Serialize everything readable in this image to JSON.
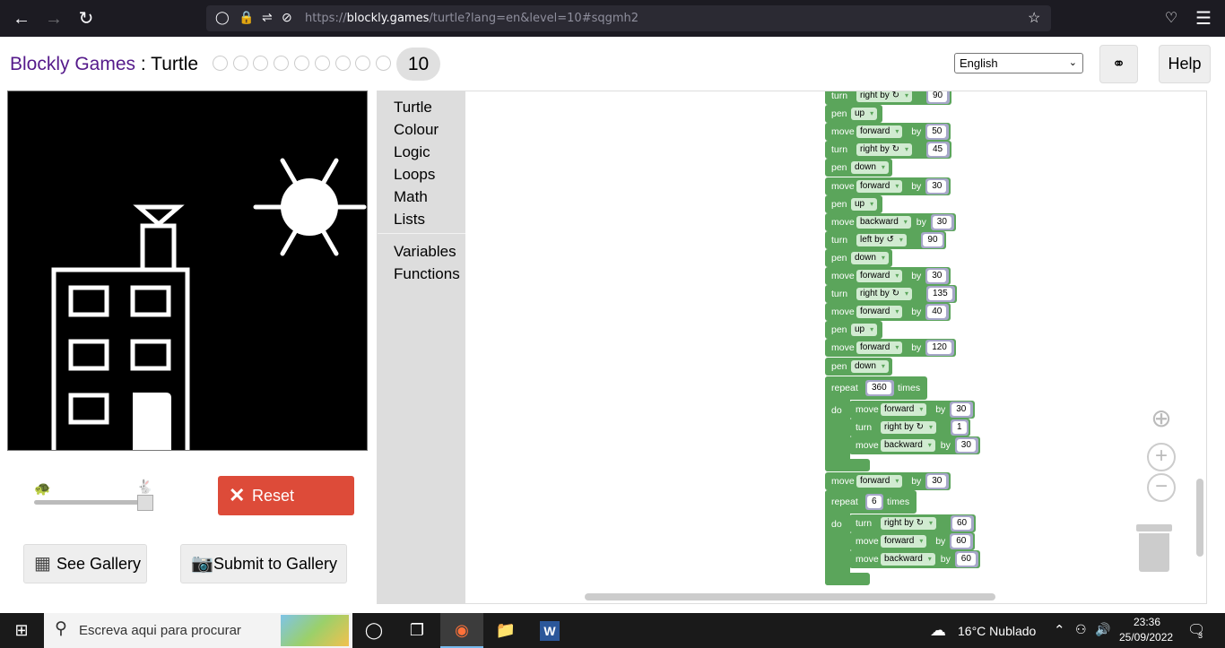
{
  "browser": {
    "url_prefix": "https://",
    "url_domain": "blockly.games",
    "url_rest": "/turtle?lang=en&level=10#sqgmh2"
  },
  "header": {
    "brand_games": "Blockly Games",
    "brand_sep": " : ",
    "brand_app": "Turtle",
    "current_level": "10",
    "language": "English",
    "help_label": "Help"
  },
  "controls": {
    "reset_label": "Reset",
    "see_gallery_label": "See Gallery",
    "submit_gallery_label": "Submit to Gallery",
    "speed_fraction": 0.97
  },
  "toolbox": {
    "items": [
      "Turtle",
      "Colour",
      "Logic",
      "Loops",
      "Math",
      "Lists",
      "Variables",
      "Functions"
    ]
  },
  "blocks": {
    "rows": [
      {
        "kw": "turn",
        "dd": "right by ↻",
        "val": "90"
      },
      {
        "kw": "pen",
        "dd": "up"
      },
      {
        "kw": "move",
        "dd": "forward",
        "by": "by",
        "val": "50"
      },
      {
        "kw": "turn",
        "dd": "right by ↻",
        "val": "45"
      },
      {
        "kw": "pen",
        "dd": "down"
      },
      {
        "kw": "move",
        "dd": "forward",
        "by": "by",
        "val": "30"
      },
      {
        "kw": "pen",
        "dd": "up"
      },
      {
        "kw": "move",
        "dd": "backward",
        "by": "by",
        "val": "30"
      },
      {
        "kw": "turn",
        "dd": "left by ↺",
        "val": "90"
      },
      {
        "kw": "pen",
        "dd": "down"
      },
      {
        "kw": "move",
        "dd": "forward",
        "by": "by",
        "val": "30"
      },
      {
        "kw": "turn",
        "dd": "right by ↻",
        "val": "135"
      },
      {
        "kw": "move",
        "dd": "forward",
        "by": "by",
        "val": "40"
      },
      {
        "kw": "pen",
        "dd": "up"
      },
      {
        "kw": "move",
        "dd": "forward",
        "by": "by",
        "val": "120"
      },
      {
        "kw": "pen",
        "dd": "down"
      }
    ],
    "repeat1": {
      "label": "repeat",
      "count": "360",
      "times": "times",
      "do": "do",
      "body": [
        {
          "kw": "move",
          "dd": "forward",
          "by": "by",
          "val": "30"
        },
        {
          "kw": "turn",
          "dd": "right by ↻",
          "val": "1"
        },
        {
          "kw": "move",
          "dd": "backward",
          "by": "by",
          "val": "30"
        }
      ]
    },
    "after": {
      "kw": "move",
      "dd": "forward",
      "by": "by",
      "val": "30"
    },
    "repeat2": {
      "label": "repeat",
      "count": "6",
      "times": "times",
      "do": "do",
      "body": [
        {
          "kw": "turn",
          "dd": "right by ↻",
          "val": "60"
        },
        {
          "kw": "move",
          "dd": "forward",
          "by": "by",
          "val": "60"
        },
        {
          "kw": "move",
          "dd": "backward",
          "by": "by",
          "val": "60"
        }
      ]
    }
  },
  "taskbar": {
    "search_placeholder": "Escreva aqui para procurar",
    "weather": "16°C  Nublado",
    "time": "23:36",
    "date": "25/09/2022",
    "notifications": "3"
  },
  "colors": {
    "turtle_block": "#5ba55b",
    "loop_block": "#5ba55b",
    "reset": "#dd4b39",
    "brand_games": "#551a8b"
  }
}
